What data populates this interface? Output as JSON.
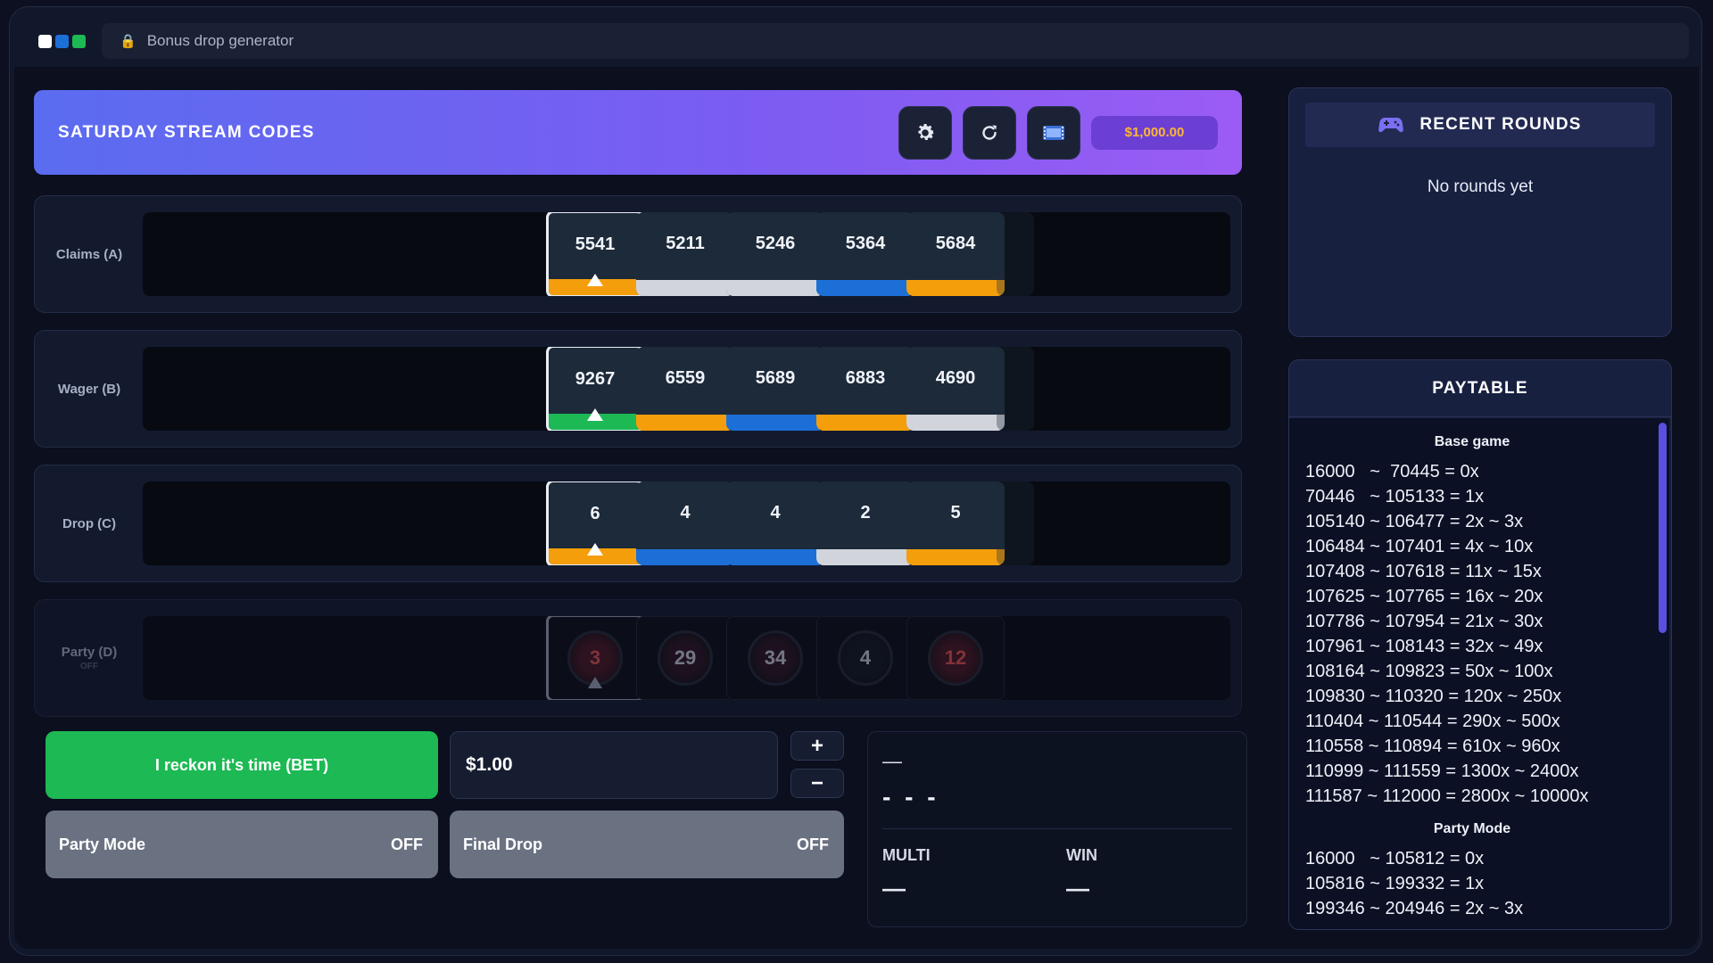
{
  "window": {
    "url_title": "Bonus drop generator",
    "dot_colors": [
      "#ffffff",
      "#1d6fd8",
      "#1db954"
    ]
  },
  "header": {
    "title": "SATURDAY STREAM CODES",
    "settings_icon": "gear-icon",
    "refresh_icon": "refresh-icon",
    "film_icon": "film-icon",
    "balance": "$1,000.00"
  },
  "rows": [
    {
      "label": "Claims (A)",
      "cells": [
        {
          "value": "5541",
          "bar": "#f59e0b",
          "selected": true
        },
        {
          "value": "5211",
          "bar": "#d1d5db"
        },
        {
          "value": "5246",
          "bar": "#d1d5db"
        },
        {
          "value": "5364",
          "bar": "#1d6fd8"
        },
        {
          "value": "5684",
          "bar": "#f59e0b"
        }
      ]
    },
    {
      "label": "Wager (B)",
      "cells": [
        {
          "value": "9267",
          "bar": "#1db954",
          "selected": true
        },
        {
          "value": "6559",
          "bar": "#f59e0b"
        },
        {
          "value": "5689",
          "bar": "#1d6fd8"
        },
        {
          "value": "6883",
          "bar": "#f59e0b"
        },
        {
          "value": "4690",
          "bar": "#d1d5db"
        }
      ]
    },
    {
      "label": "Drop (C)",
      "cells": [
        {
          "value": "6",
          "bar": "#f59e0b",
          "selected": true
        },
        {
          "value": "4",
          "bar": "#1d6fd8"
        },
        {
          "value": "4",
          "bar": "#1d6fd8"
        },
        {
          "value": "2",
          "bar": "#d1d5db"
        },
        {
          "value": "5",
          "bar": "#f59e0b"
        }
      ]
    }
  ],
  "party_row": {
    "label": "Party (D)",
    "status": "OFF",
    "cells": [
      "3",
      "29",
      "34",
      "4",
      "12"
    ]
  },
  "controls": {
    "bet_label": "I reckon it's time (BET)",
    "stake": "$1.00",
    "plus": "+",
    "minus": "−",
    "party_mode_label": "Party Mode",
    "party_mode_state": "OFF",
    "final_drop_label": "Final Drop",
    "final_drop_state": "OFF"
  },
  "result": {
    "top": "—",
    "main": "- - -",
    "multi_label": "MULTI",
    "multi_value": "—",
    "win_label": "WIN",
    "win_value": "—"
  },
  "recent": {
    "title": "RECENT ROUNDS",
    "icon": "gamepad-icon",
    "empty": "No rounds yet"
  },
  "paytable": {
    "title": "PAYTABLE",
    "base_title": "Base game",
    "base": [
      "16000   ~  70445 = 0x",
      "70446   ~ 105133 = 1x",
      "105140 ~ 106477 = 2x ~ 3x",
      "106484 ~ 107401 = 4x ~ 10x",
      "107408 ~ 107618 = 11x ~ 15x",
      "107625 ~ 107765 = 16x ~ 20x",
      "107786 ~ 107954 = 21x ~ 30x",
      "107961 ~ 108143 = 32x ~ 49x",
      "108164 ~ 109823 = 50x ~ 100x",
      "109830 ~ 110320 = 120x ~ 250x",
      "110404 ~ 110544 = 290x ~ 500x",
      "110558 ~ 110894 = 610x ~ 960x",
      "110999 ~ 111559 = 1300x ~ 2400x",
      "111587 ~ 112000 = 2800x ~ 10000x"
    ],
    "party_title": "Party Mode",
    "party": [
      "16000   ~ 105812 = 0x",
      "105816 ~ 199332 = 1x",
      "199346 ~ 204946 = 2x ~ 3x"
    ]
  }
}
